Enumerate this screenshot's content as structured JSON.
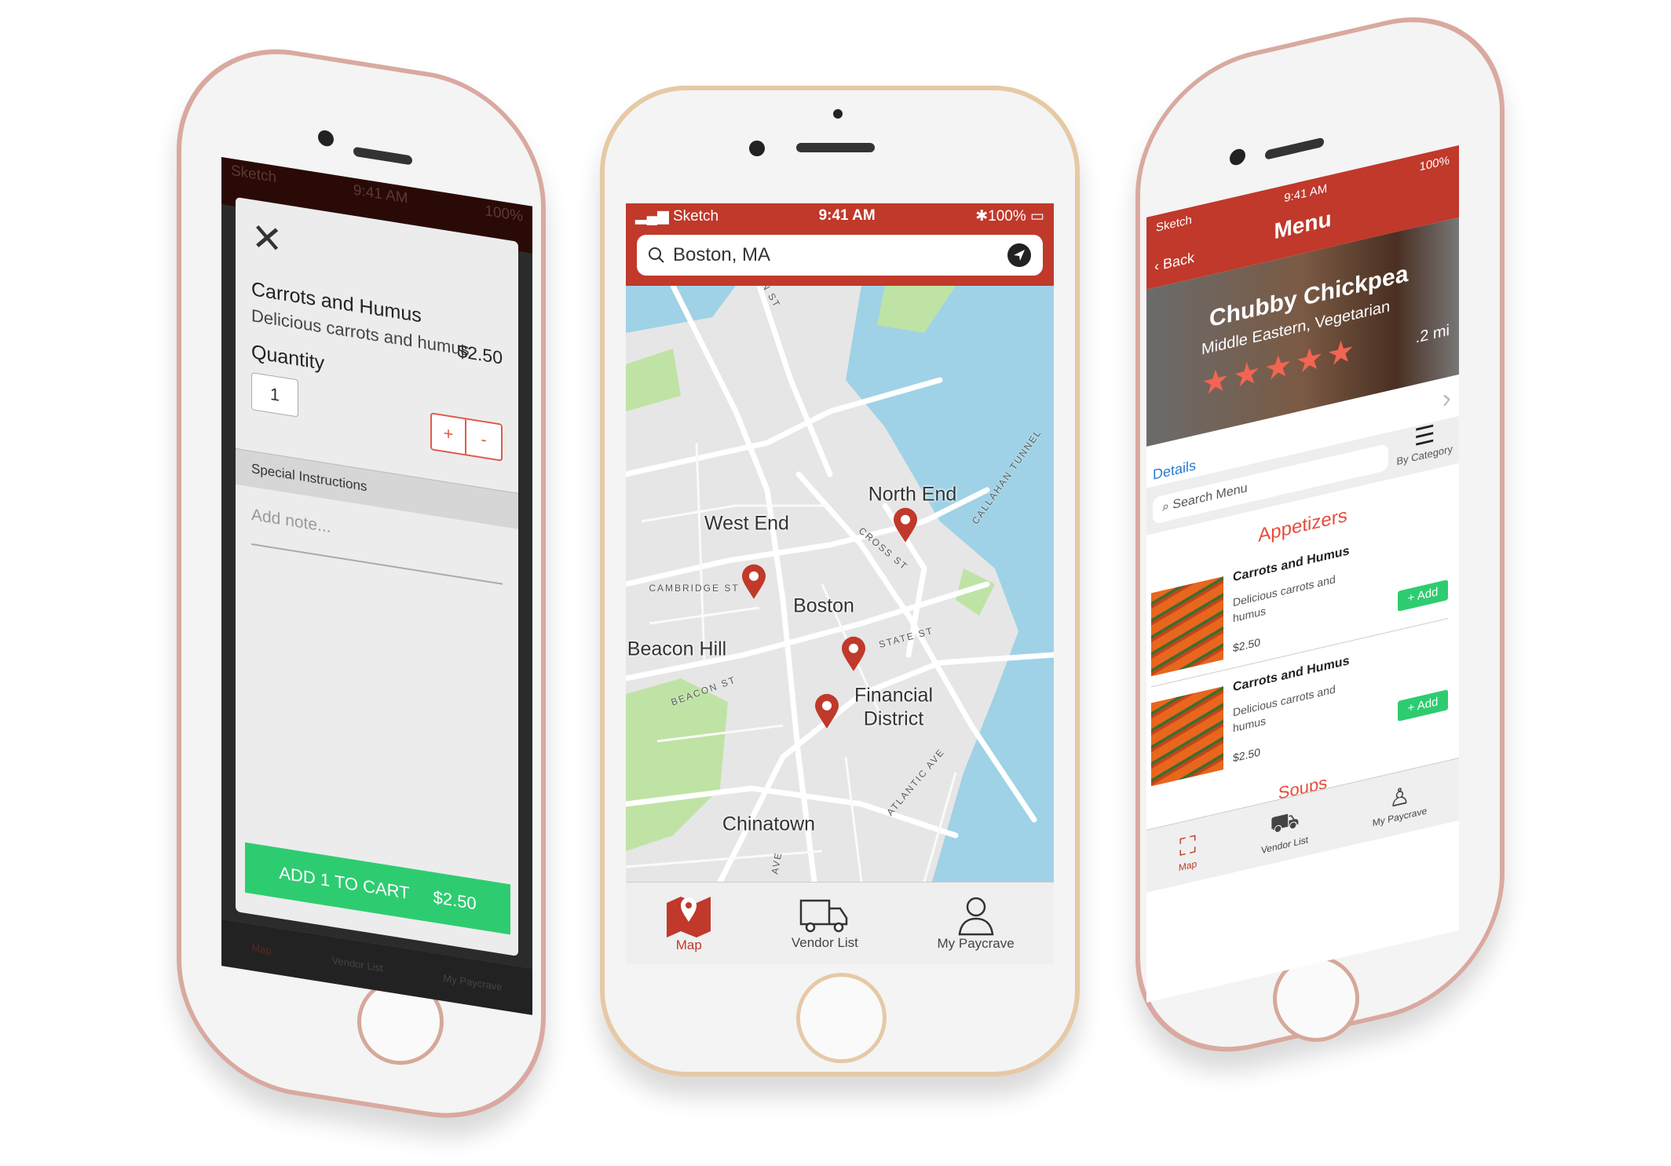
{
  "status_bar": {
    "carrier": "Sketch",
    "time": "9:41 AM",
    "battery": "100%"
  },
  "colors": {
    "brand_red": "#c0392b",
    "add_green": "#2ecc71",
    "link_blue": "#2a7bd1",
    "star": "#f26552",
    "water": "#9fd2e6",
    "park": "#bfe3a4"
  },
  "tabs": [
    {
      "label": "Map",
      "icon": "map-pin-icon"
    },
    {
      "label": "Vendor List",
      "icon": "truck-icon"
    },
    {
      "label": "My Paycrave",
      "icon": "user-icon"
    }
  ],
  "item_modal": {
    "close_icon": "close-icon",
    "name": "Carrots and Humus",
    "description": "Delicious carrots and humus",
    "price": "$2.50",
    "quantity_label": "Quantity",
    "quantity": "1",
    "plus": "+",
    "minus": "-",
    "special_instructions": "Special Instructions",
    "note_placeholder": "Add note...",
    "add_button": "ADD 1 TO CART",
    "add_button_price": "$2.50"
  },
  "map_screen": {
    "search_value": "Boston, MA",
    "neighborhoods": [
      "North End",
      "West End",
      "Boston",
      "Beacon Hill",
      "Financial",
      "District",
      "Chinatown"
    ],
    "streets": [
      "CAMBRIDGE ST",
      "BEACON ST",
      "STATE ST",
      "CROSS ST",
      "CALLAHAN TUNNEL",
      "ATLANTIC AVE",
      "N ST",
      "AVE"
    ]
  },
  "menu_screen": {
    "back": "Back",
    "title": "Menu",
    "restaurant": "Chubby Chickpea",
    "cuisine": "Middle Eastern, Vegetarian",
    "rating": 5,
    "distance": ".2 mi",
    "details": "Details",
    "search_placeholder": "Search Menu",
    "by_category": "By Category",
    "sections": [
      {
        "title": "Appetizers",
        "items": [
          {
            "name": "Carrots and Humus",
            "description": "Delicious carrots and humus",
            "price": "$2.50",
            "add": "+ Add"
          },
          {
            "name": "Carrots and Humus",
            "description": "Delicious carrots and humus",
            "price": "$2.50",
            "add": "+ Add"
          }
        ]
      },
      {
        "title": "Soups",
        "items": []
      }
    ]
  }
}
